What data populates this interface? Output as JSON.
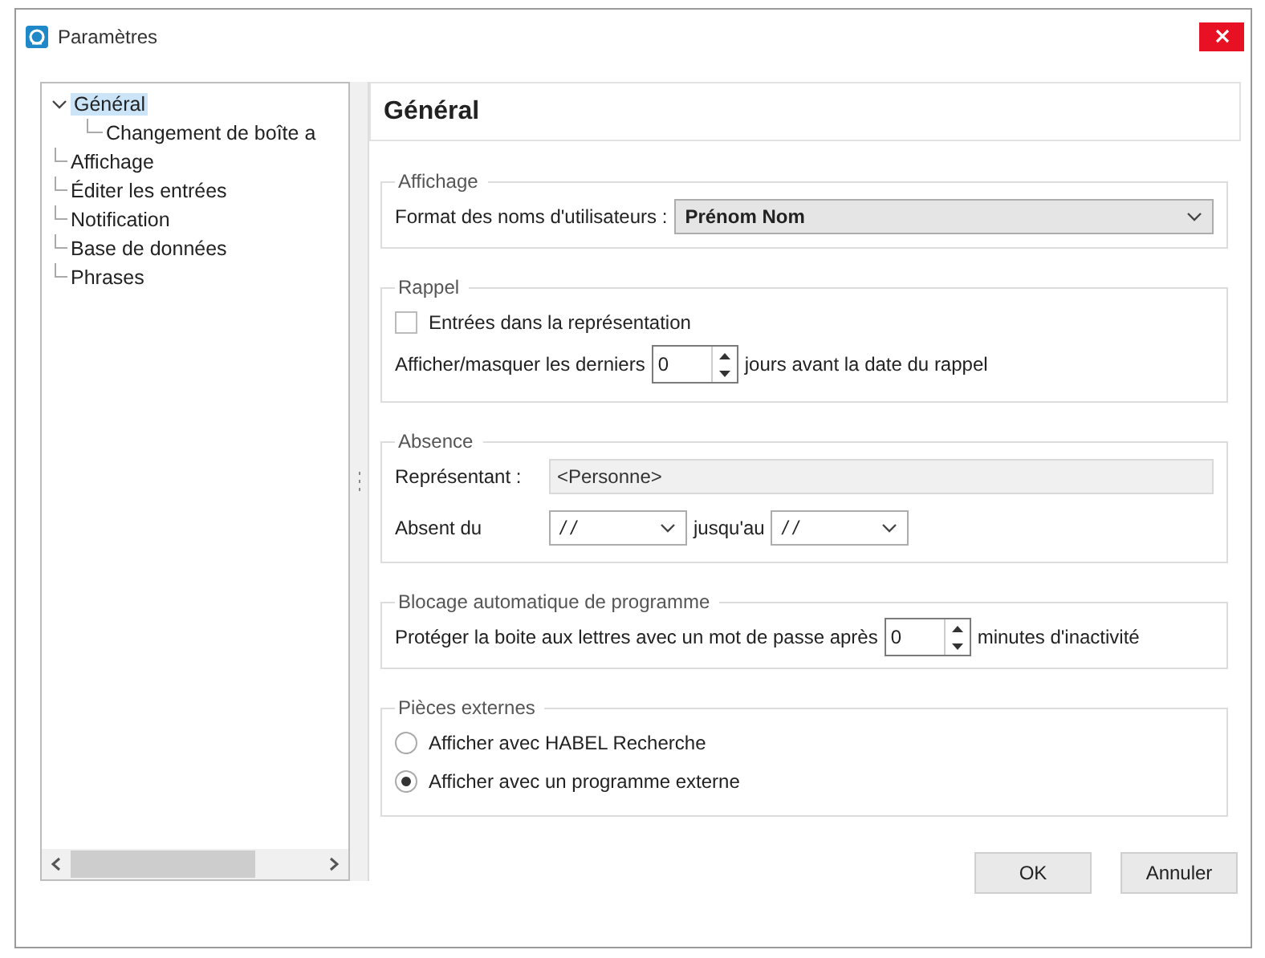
{
  "window": {
    "title": "Paramètres"
  },
  "tree": [
    {
      "label": "Général",
      "selected": true,
      "expanded": true,
      "children": [
        {
          "label": "Changement de boîte a",
          "selected": false
        }
      ]
    },
    {
      "label": "Affichage",
      "selected": false
    },
    {
      "label": "Éditer les entrées",
      "selected": false
    },
    {
      "label": "Notification",
      "selected": false
    },
    {
      "label": "Base de données",
      "selected": false
    },
    {
      "label": "Phrases",
      "selected": false
    }
  ],
  "panel": {
    "title": "Général"
  },
  "display_group": {
    "title": "Affichage",
    "name_format": {
      "label": "Format des noms d'utilisateurs :",
      "value": "Prénom Nom"
    }
  },
  "reminder_group": {
    "title": "Rappel",
    "checkbox": {
      "label": "Entrées dans la représentation",
      "checked": false
    },
    "days": {
      "label_before": "Afficher/masquer les derniers",
      "value": "0",
      "label_after": "jours avant la date du rappel"
    }
  },
  "absence_group": {
    "title": "Absence",
    "representative": {
      "label": "Représentant :",
      "value": "<Personne>"
    },
    "from": {
      "label": "Absent du",
      "value": "/ /"
    },
    "to": {
      "label": "jusqu'au",
      "value": "/ /"
    }
  },
  "lock_group": {
    "title": "Blocage automatique de programme",
    "minutes": {
      "label_before": "Protéger la boite aux lettres avec un mot de passe après",
      "value": "0",
      "label_after": "minutes d'inactivité"
    }
  },
  "external_group": {
    "title": "Pièces externes",
    "options": [
      {
        "label": "Afficher avec HABEL Recherche",
        "selected": false
      },
      {
        "label": "Afficher avec un programme externe",
        "selected": true
      }
    ]
  },
  "buttons": [
    "OK",
    "Annuler"
  ]
}
